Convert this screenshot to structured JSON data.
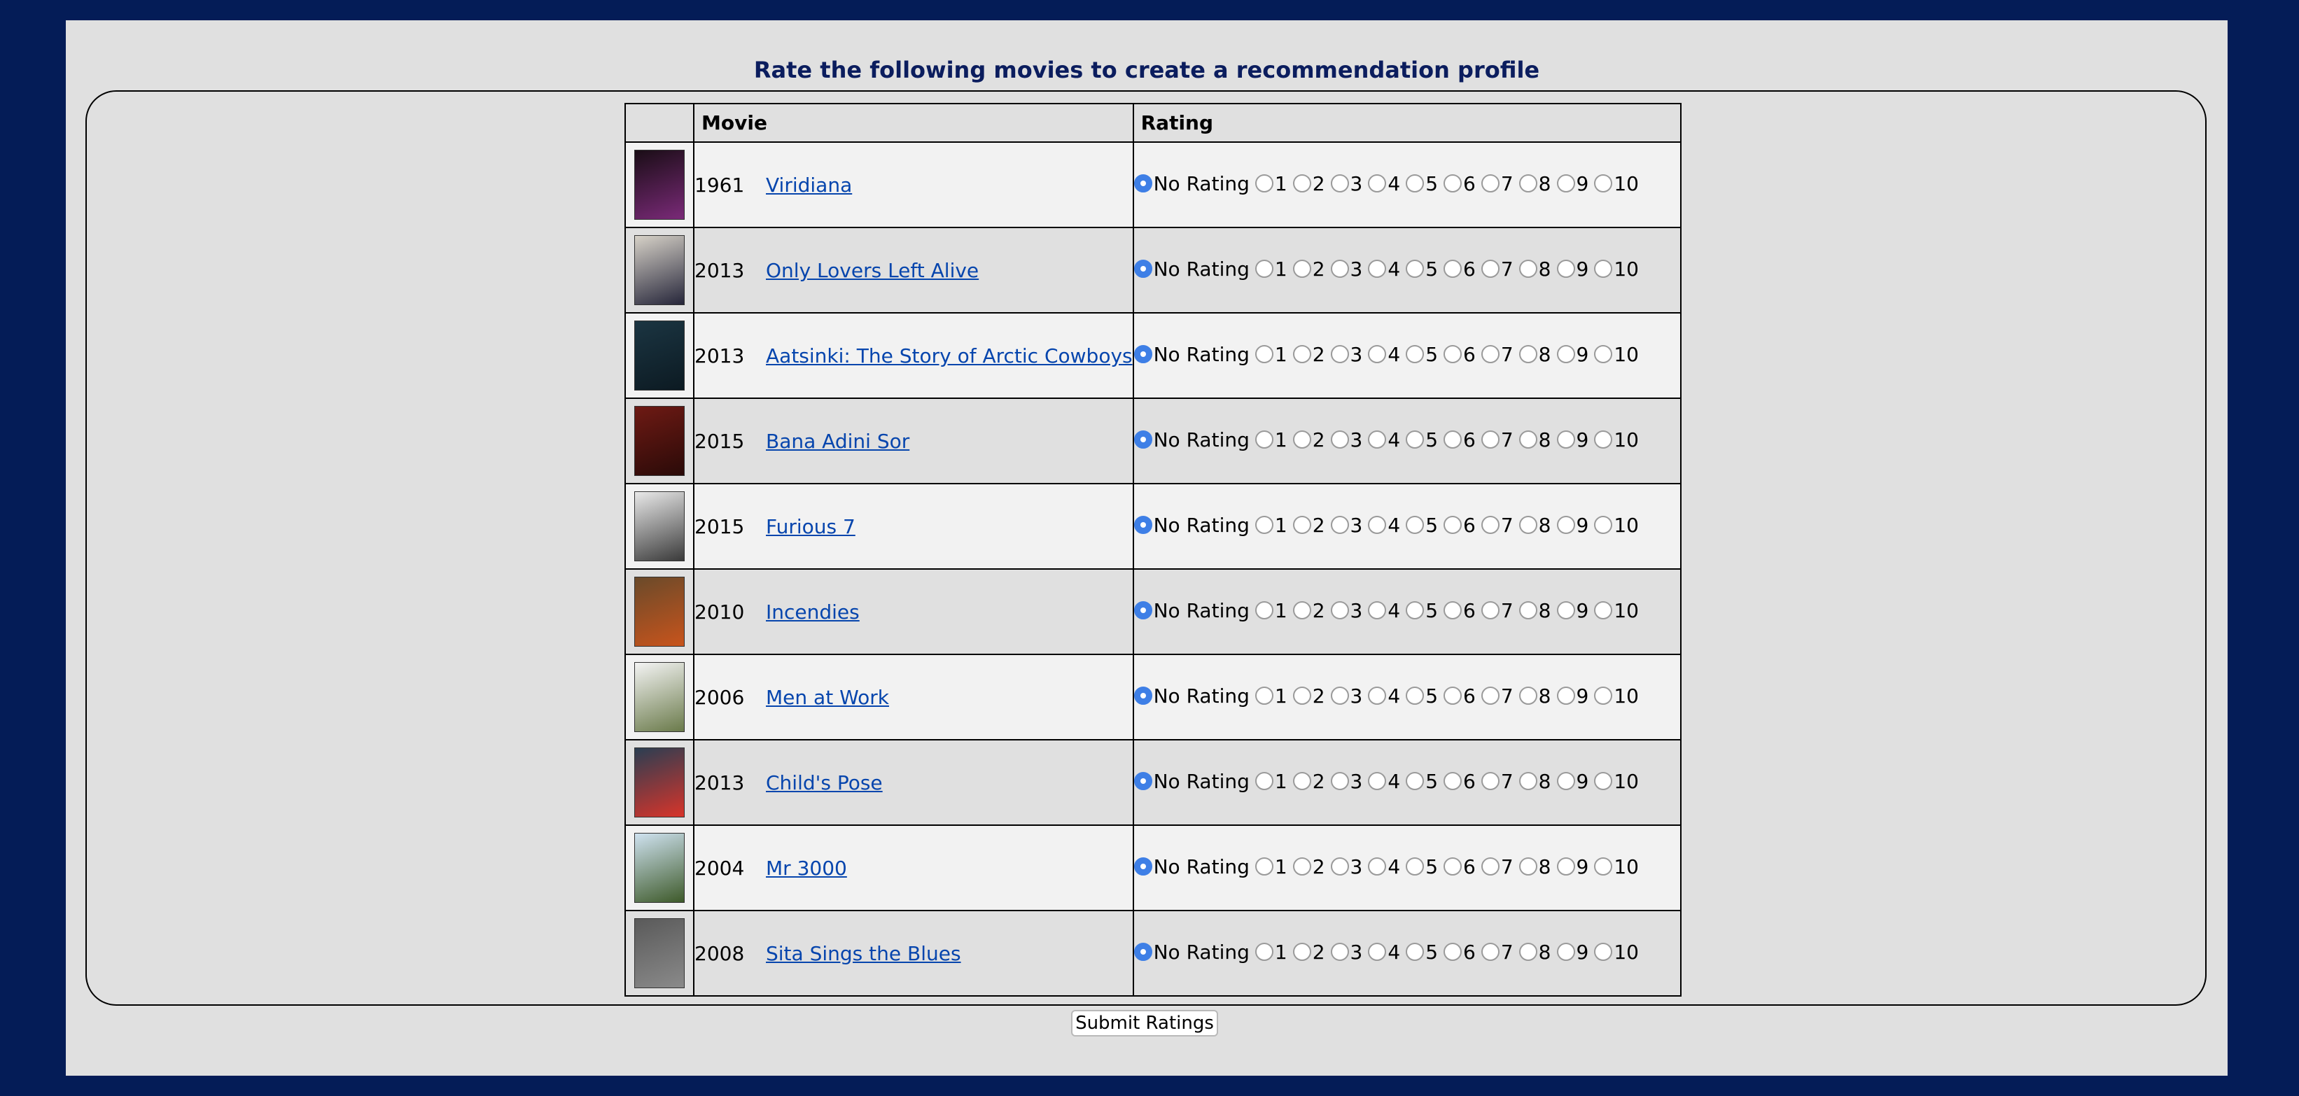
{
  "page": {
    "title": "Rate the following movies to create a recommendation profile"
  },
  "table": {
    "headers": {
      "poster": "",
      "movie": "Movie",
      "rating": "Rating"
    },
    "rating_options": [
      "No Rating",
      "1",
      "2",
      "3",
      "4",
      "5",
      "6",
      "7",
      "8",
      "9",
      "10"
    ],
    "selected_default": "No Rating",
    "rows": [
      {
        "year": "1961",
        "title": "Viridiana",
        "selected": "No Rating",
        "poster_colors": [
          "#1a0d16",
          "#7a2a78"
        ]
      },
      {
        "year": "2013",
        "title": "Only Lovers Left Alive",
        "selected": "No Rating",
        "poster_colors": [
          "#d7d2c8",
          "#26263a"
        ]
      },
      {
        "year": "2013",
        "title": "Aatsinki: The Story of Arctic Cowboys",
        "selected": "No Rating",
        "poster_colors": [
          "#1b3542",
          "#0c1a22"
        ]
      },
      {
        "year": "2015",
        "title": "Bana Adini Sor",
        "selected": "No Rating",
        "poster_colors": [
          "#6e1a14",
          "#2a0a08"
        ]
      },
      {
        "year": "2015",
        "title": "Furious 7",
        "selected": "No Rating",
        "poster_colors": [
          "#e9e9e9",
          "#3a3a3a"
        ]
      },
      {
        "year": "2010",
        "title": "Incendies",
        "selected": "No Rating",
        "poster_colors": [
          "#6a4a2a",
          "#c8541c"
        ]
      },
      {
        "year": "2006",
        "title": "Men at Work",
        "selected": "No Rating",
        "poster_colors": [
          "#f4f4f4",
          "#6a7a4a"
        ]
      },
      {
        "year": "2013",
        "title": "Child's Pose",
        "selected": "No Rating",
        "poster_colors": [
          "#2a3e52",
          "#d8342a"
        ]
      },
      {
        "year": "2004",
        "title": "Mr 3000",
        "selected": "No Rating",
        "poster_colors": [
          "#cfe2f0",
          "#3e5a2a"
        ]
      },
      {
        "year": "2008",
        "title": "Sita Sings the Blues",
        "selected": "No Rating",
        "poster_colors": [
          "#5a5a5a",
          "#8a8a8a"
        ]
      }
    ]
  },
  "submit": {
    "label": "Submit Ratings"
  },
  "colors": {
    "outer_background": "#041c57",
    "page_background": "#e0e0e0",
    "title_color": "#0b1d5e",
    "link_color": "#0645ad",
    "radio_selected": "#3e7fe6"
  }
}
